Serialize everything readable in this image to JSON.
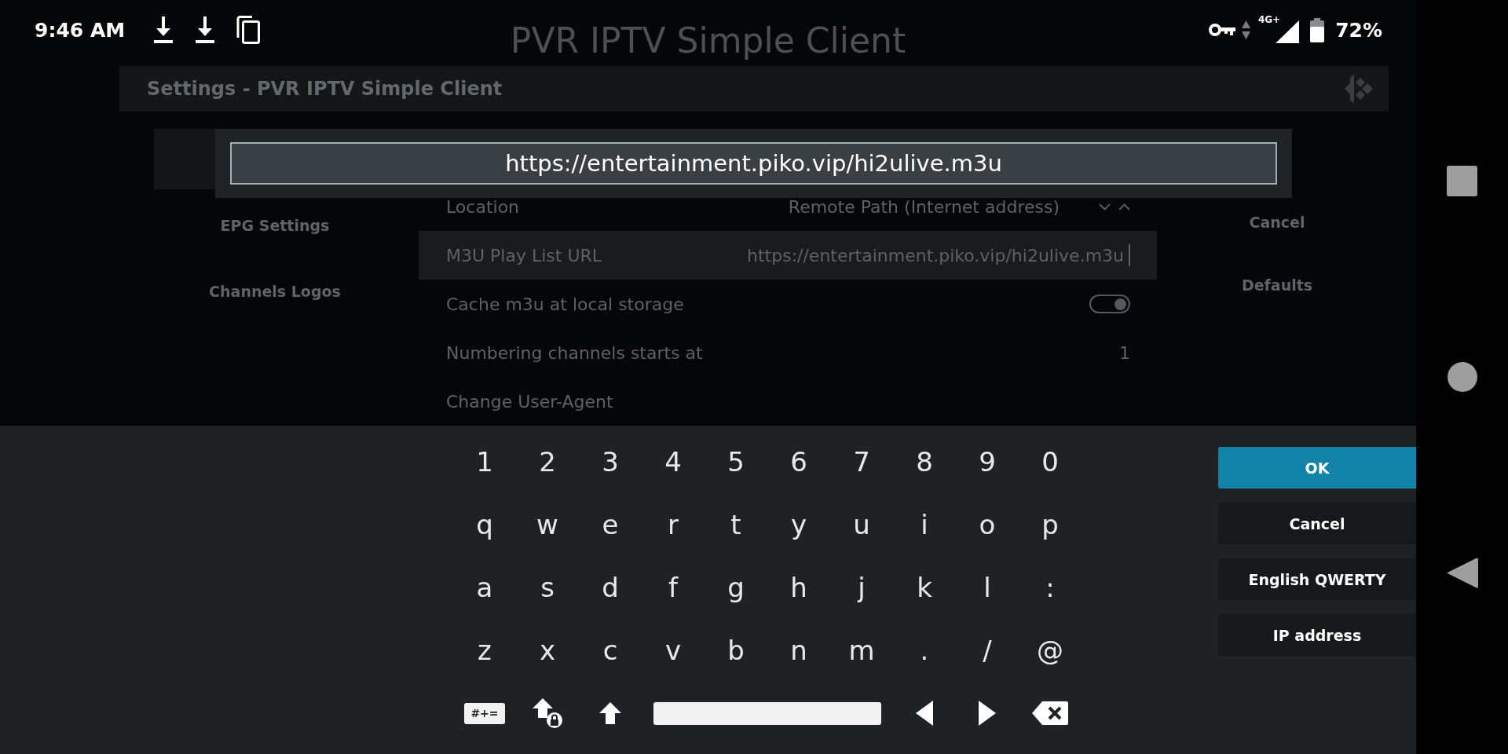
{
  "status_bar": {
    "time": "9:46 AM",
    "network_type": "4G+",
    "battery": "72%"
  },
  "background_title": "PVR IPTV Simple Client",
  "settings_window": {
    "title": "Settings - PVR IPTV Simple Client",
    "categories": [
      {
        "label": "EPG Settings"
      },
      {
        "label": "Channels Logos"
      }
    ],
    "settings": [
      {
        "kind": "select",
        "label": "Location",
        "value": "Remote Path (Internet address)",
        "selected": false
      },
      {
        "kind": "text",
        "label": "M3U Play List URL",
        "value": "https://entertainment.piko.vip/hi2ulive.m3u",
        "selected": true
      },
      {
        "kind": "toggle",
        "label": "Cache m3u at local storage",
        "on": true,
        "selected": false
      },
      {
        "kind": "number",
        "label": "Numbering channels starts at",
        "value": "1",
        "selected": false
      },
      {
        "kind": "action",
        "label": "Change User-Agent",
        "selected": false
      }
    ],
    "buttons": [
      "Cancel",
      "Defaults"
    ]
  },
  "input_dialog": {
    "value": "https://entertainment.piko.vip/hi2ulive.m3u"
  },
  "keyboard": {
    "rows": [
      [
        "1",
        "2",
        "3",
        "4",
        "5",
        "6",
        "7",
        "8",
        "9",
        "0"
      ],
      [
        "q",
        "w",
        "e",
        "r",
        "t",
        "y",
        "u",
        "i",
        "o",
        "p"
      ],
      [
        "a",
        "s",
        "d",
        "f",
        "g",
        "h",
        "j",
        "k",
        "l",
        ":"
      ],
      [
        "z",
        "x",
        "c",
        "v",
        "b",
        "n",
        "m",
        ".",
        "/",
        "@"
      ]
    ],
    "bottom_row": [
      {
        "kind": "symbols",
        "label": "#+="
      },
      {
        "kind": "caps_lock"
      },
      {
        "kind": "shift"
      },
      {
        "kind": "space"
      },
      {
        "kind": "cursor_left"
      },
      {
        "kind": "cursor_right"
      },
      {
        "kind": "backspace"
      }
    ]
  },
  "side_buttons": [
    {
      "label": "OK",
      "selected": true
    },
    {
      "label": "Cancel",
      "selected": false
    },
    {
      "label": "English QWERTY",
      "selected": false
    },
    {
      "label": "IP address",
      "selected": false
    }
  ]
}
